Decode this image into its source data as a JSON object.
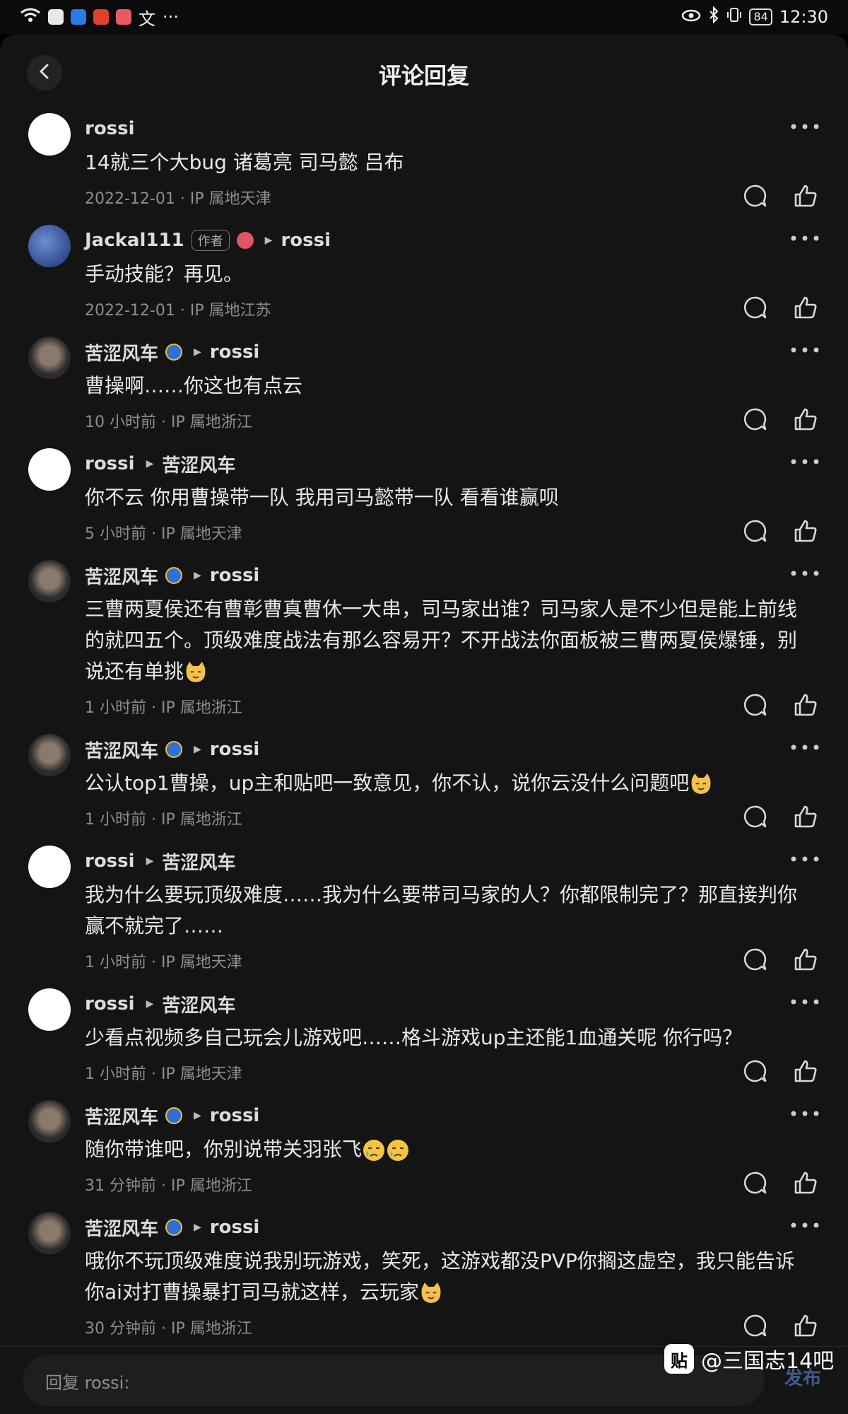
{
  "status_bar": {
    "time": "12:30",
    "battery": "84",
    "ime_label": "文",
    "more": "···"
  },
  "header": {
    "title": "评论回复"
  },
  "comments": [
    {
      "author": "rossi",
      "avatar": "rossi",
      "text": "14就三个大bug 诸葛亮 司马懿 吕布",
      "time": "2022-12-01 · IP 属地天津"
    },
    {
      "author": "Jackal111",
      "author_tag": "作者",
      "avatar": "jackal",
      "reply_to": "rossi",
      "text": "手动技能？再见。",
      "time": "2022-12-01 · IP 属地江苏"
    },
    {
      "author": "苦涩风车",
      "avatar": "ku",
      "reply_to": "rossi",
      "text": "曹操啊……你这也有点云",
      "time": "10 小时前 · IP 属地浙江"
    },
    {
      "author": "rossi",
      "avatar": "rossi",
      "reply_to": "苦涩风车",
      "text": "你不云 你用曹操带一队 我用司马懿带一队 看看谁赢呗",
      "time": "5 小时前 · IP 属地天津"
    },
    {
      "author": "苦涩风车",
      "avatar": "ku",
      "reply_to": "rossi",
      "text": "三曹两夏侯还有曹彰曹真曹休一大串，司马家出谁？司马家人是不少但是能上前线的就四五个。顶级难度战法有那么容易开？不开战法你面板被三曹两夏侯爆锤，别说还有单挑",
      "time": "1 小时前 · IP 属地浙江"
    },
    {
      "author": "苦涩风车",
      "avatar": "ku",
      "reply_to": "rossi",
      "text": "公认top1曹操，up主和贴吧一致意见，你不认，说你云没什么问题吧",
      "time": "1 小时前 · IP 属地浙江"
    },
    {
      "author": "rossi",
      "avatar": "rossi",
      "reply_to": "苦涩风车",
      "text": "我为什么要玩顶级难度……我为什么要带司马家的人？你都限制完了？那直接判你赢不就完了……",
      "time": "1 小时前 · IP 属地天津"
    },
    {
      "author": "rossi",
      "avatar": "rossi",
      "reply_to": "苦涩风车",
      "text": "少看点视频多自己玩会儿游戏吧……格斗游戏up主还能1血通关呢 你行吗？",
      "time": "1 小时前 · IP 属地天津"
    },
    {
      "author": "苦涩风车",
      "avatar": "ku",
      "reply_to": "rossi",
      "text": "随你带谁吧，你别说带关羽张飞",
      "time": "31 分钟前 · IP 属地浙江"
    },
    {
      "author": "苦涩风车",
      "avatar": "ku",
      "reply_to": "rossi",
      "text": "哦你不玩顶级难度说我别玩游戏，笑死，这游戏都没PVP你搁这虚空，我只能告诉你ai对打曹操暴打司马就这样，云玩家",
      "time": "30 分钟前 · IP 属地浙江"
    }
  ],
  "reply_bar": {
    "placeholder": "回复 rossi:",
    "send": "发布"
  },
  "watermark": {
    "logo": "贴",
    "text": "@三国志14吧"
  }
}
